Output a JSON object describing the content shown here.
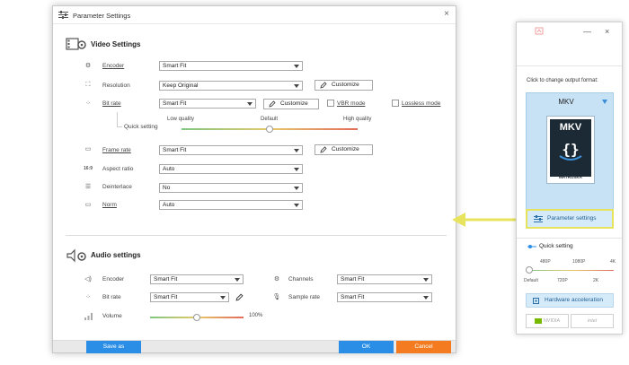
{
  "dialog": {
    "title": "Parameter Settings",
    "close": "×"
  },
  "video": {
    "heading": "Video Settings",
    "encoder": {
      "label": "Encoder",
      "value": "Smart Fit"
    },
    "resolution": {
      "label": "Resolution",
      "value": "Keep Original",
      "button": "Customize"
    },
    "bitrate": {
      "label": "Bit rate",
      "value": "Smart Fit",
      "button": "Customize",
      "vbr_label": "VBR mode",
      "lossless_label": "Lossless mode"
    },
    "quick_setting": {
      "label": "Quick setting",
      "low": "Low quality",
      "default": "Default",
      "high": "High quality",
      "level": 0.5
    },
    "framerate": {
      "label": "Frame rate",
      "value": "Smart Fit",
      "button": "Customize"
    },
    "aspect": {
      "label": "Aspect ratio",
      "value": "Auto",
      "icon_text": "16:9"
    },
    "deinterlace": {
      "label": "Deinterlace",
      "value": "No"
    },
    "norm": {
      "label": "Norm",
      "value": "Auto"
    }
  },
  "audio": {
    "heading": "Audio settings",
    "encoder": {
      "label": "Encoder",
      "value": "Smart Fit"
    },
    "channels": {
      "label": "Channels",
      "value": "Smart Fit"
    },
    "bitrate": {
      "label": "Bit rate",
      "value": "Smart Fit"
    },
    "samplerate": {
      "label": "Sample rate",
      "value": "Smart Fit"
    },
    "volume": {
      "label": "Volume",
      "value": "100%",
      "level": 0.5
    }
  },
  "footer": {
    "save_as": "Save as",
    "ok": "OK",
    "cancel": "Cancel"
  },
  "panel": {
    "minimize": "—",
    "close": "×",
    "change_format": "Click to change output format:",
    "format": "MKV",
    "logo_text": "MKV",
    "logo_sub": "MATROŠKA",
    "param_button": "Parameter settings",
    "quick_setting": "Quick setting",
    "ticks_top": [
      "480P",
      "1080P",
      "4K"
    ],
    "ticks_bottom": [
      "Default",
      "720P",
      "2K"
    ],
    "hw_button": "Hardware acceleration",
    "chip_nvidia": "NVIDIA",
    "chip_intel": "intel"
  },
  "colors": {
    "accent_blue": "#2b8ee6",
    "cancel_orange": "#f47b20",
    "callout_yellow": "#e7e35c",
    "nvidia_green": "#76b900"
  }
}
